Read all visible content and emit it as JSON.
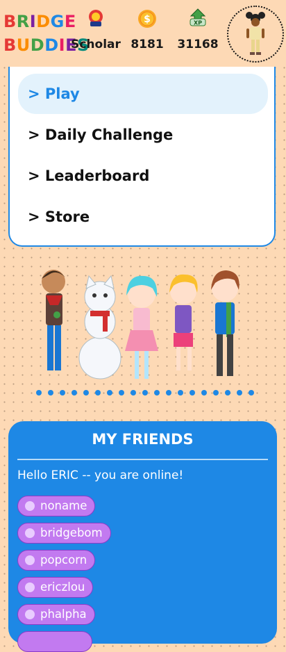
{
  "header": {
    "logo_line1": [
      "B",
      "R",
      "I",
      "D",
      "G",
      "E"
    ],
    "logo_line2": [
      "B",
      "U",
      "D",
      "D",
      "I",
      "E",
      "S"
    ],
    "logo_colors1": [
      "#e53935",
      "#43a047",
      "#7b1fa2",
      "#fb8c00",
      "#1e88e5",
      "#e91e63"
    ],
    "logo_colors2": [
      "#e53935",
      "#fb8c00",
      "#43a047",
      "#1e88e5",
      "#e91e63",
      "#7b1fa2",
      "#00897b"
    ],
    "rank_label": "Scholar",
    "coins": "8181",
    "xp": "31168",
    "xp_badge": "XP"
  },
  "menu": {
    "items": [
      "> Play",
      "> Daily Challenge",
      "> Leaderboard",
      "> Store"
    ],
    "active_index": 0
  },
  "friends": {
    "title": "MY FRIENDS",
    "online_message": "Hello ERIC -- you are online!",
    "list": [
      "noname",
      "bridgebom",
      "popcorn",
      "ericzlou",
      "phalpha"
    ]
  },
  "colors": {
    "accent_blue": "#1e88e5",
    "background_peach": "#fdd9b5",
    "chip_purple": "#c27af0"
  }
}
